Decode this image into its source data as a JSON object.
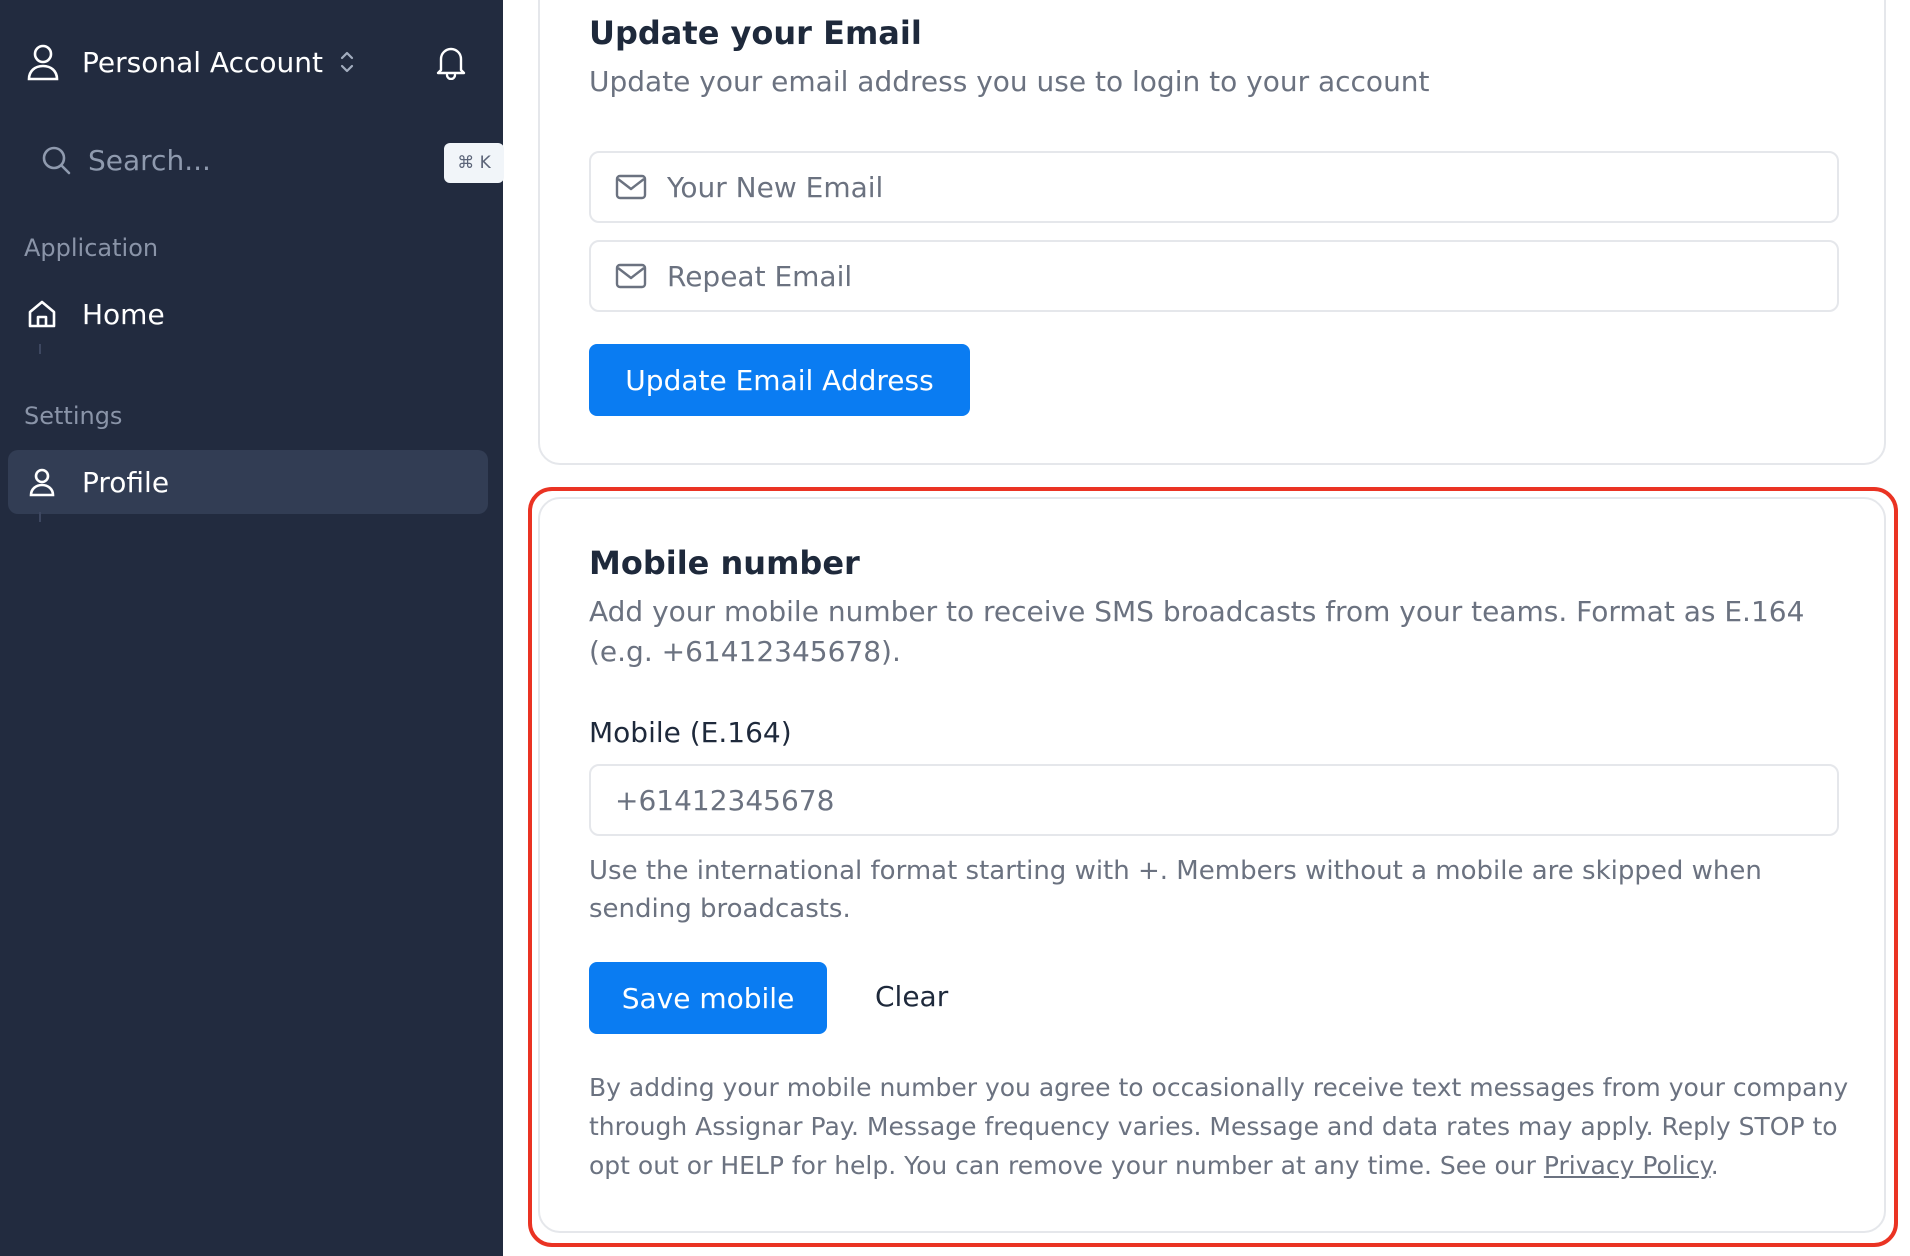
{
  "sidebar": {
    "account_label": "Personal Account",
    "search_placeholder": "Search...",
    "shortcut": "⌘ K",
    "groups": [
      {
        "label": "Application",
        "items": [
          {
            "label": "Home",
            "icon": "home-icon"
          }
        ]
      },
      {
        "label": "Settings",
        "items": [
          {
            "label": "Profile",
            "icon": "user-icon",
            "active": true
          }
        ]
      }
    ]
  },
  "email_card": {
    "title": "Update your Email",
    "description": "Update your email address you use to login to your account",
    "new_email_placeholder": "Your New Email",
    "repeat_email_placeholder": "Repeat Email",
    "submit_label": "Update Email Address"
  },
  "mobile_card": {
    "title": "Mobile number",
    "description": "Add your mobile number to receive SMS broadcasts from your teams. Format as E.164 (e.g. +61412345678).",
    "field_label": "Mobile (E.164)",
    "field_value": "+61412345678",
    "help_text": "Use the international format starting with +. Members without a mobile are skipped when sending broadcasts.",
    "save_label": "Save mobile",
    "clear_label": "Clear",
    "legal_text": "By adding your mobile number you agree to occasionally receive text messages from your company through Assignar Pay. Message frequency varies. Message and data rates may apply. Reply STOP to opt out or HELP for help. You can remove your number at any time. See our ",
    "privacy_link": "Privacy Policy",
    "legal_end": "."
  },
  "colors": {
    "sidebar_bg": "#222b3f",
    "active_item_bg": "#323d54",
    "primary": "#0a7cf2",
    "highlight": "#ea3323"
  }
}
